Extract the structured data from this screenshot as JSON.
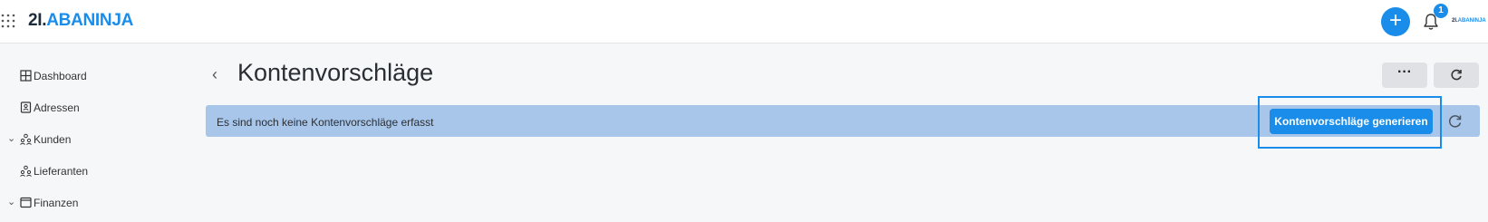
{
  "topbar": {
    "logo_part1": "2I.",
    "logo_part2": "ABANINJA",
    "plus_label": "+",
    "notification_count": "1",
    "account_logo_part1": "2I.",
    "account_logo_part2": "ABANINJA"
  },
  "sidebar": {
    "items": [
      {
        "label": "Dashboard",
        "icon": "dashboard-icon",
        "expandable": false
      },
      {
        "label": "Adressen",
        "icon": "address-book-icon",
        "expandable": false
      },
      {
        "label": "Kunden",
        "icon": "people-icon",
        "expandable": true
      },
      {
        "label": "Lieferanten",
        "icon": "people-icon",
        "expandable": false
      },
      {
        "label": "Finanzen",
        "icon": "window-icon",
        "expandable": true
      }
    ]
  },
  "page": {
    "back_label": "‹",
    "title": "Kontenvorschläge",
    "more_label": "···"
  },
  "banner": {
    "message": "Es sind noch keine Kontenvorschläge erfasst",
    "generate_button": "Kontenvorschläge generieren"
  },
  "colors": {
    "accent": "#1a8dea",
    "banner_bg": "#a8c6ea",
    "page_bg": "#f6f7f8"
  }
}
